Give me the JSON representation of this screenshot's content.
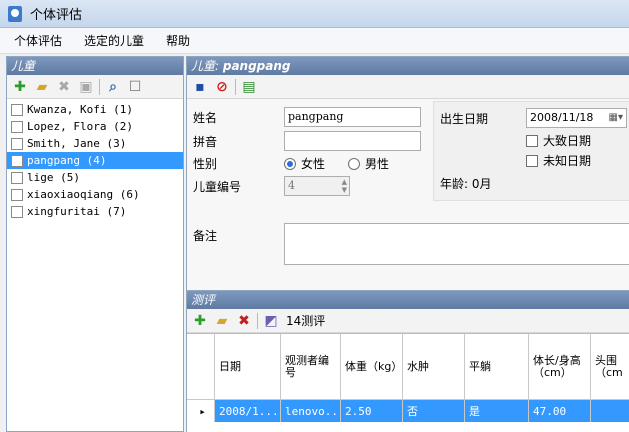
{
  "window": {
    "title": "个体评估"
  },
  "menu": [
    "个体评估",
    "选定的儿童",
    "帮助"
  ],
  "children_panel": {
    "header": "儿童",
    "items": [
      {
        "label": "Kwanza, Kofi (1)"
      },
      {
        "label": "Lopez, Flora (2)"
      },
      {
        "label": "Smith, Jane (3)"
      },
      {
        "label": "pangpang (4)"
      },
      {
        "label": "lige (5)"
      },
      {
        "label": "xiaoxiaoqiang (6)"
      },
      {
        "label": "xingfuritai (7)"
      }
    ]
  },
  "detail_panel": {
    "header_prefix": "儿童: ",
    "header_name": "pangpang",
    "name_label": "姓名",
    "name_value": "pangpang",
    "pinyin_label": "拼音",
    "pinyin_value": "",
    "gender_label": "性别",
    "female_label": "女性",
    "male_label": "男性",
    "id_label": "儿童编号",
    "id_value": "4",
    "birth_label": "出生日期",
    "birth_value": "2008/11/18",
    "approx_label": "大致日期",
    "unknown_label": "未知日期",
    "age_text": "年龄: 0月",
    "notes_label": "备注",
    "notes_value": ""
  },
  "assessment_panel": {
    "header": "测评",
    "count_label": "14测评",
    "columns": [
      "日期",
      "观测者编号",
      "体重（kg）",
      "水肿",
      "平躺",
      "体长/身高（cm）",
      "头围（cm"
    ],
    "row": [
      "2008/1...",
      "lenovo...",
      "2.50",
      "否",
      "是",
      "47.00",
      ""
    ]
  }
}
